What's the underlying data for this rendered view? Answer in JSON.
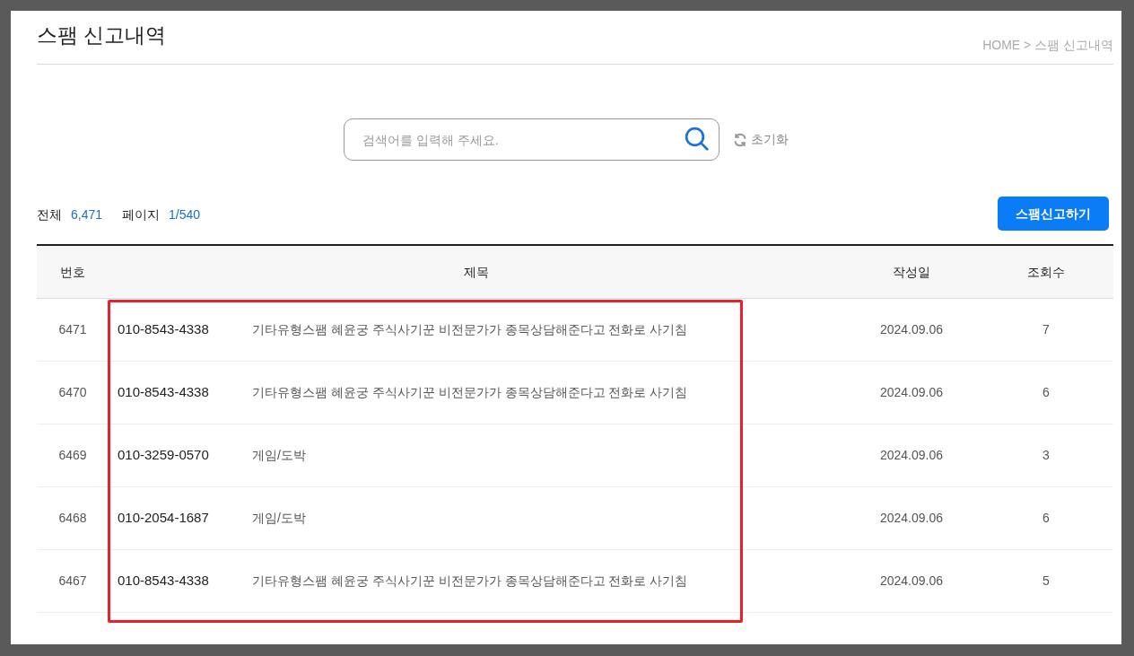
{
  "page_title": "스팸 신고내역",
  "breadcrumb": "HOME > 스팸 신고내역",
  "search": {
    "placeholder": "검색어를 입력해 주세요.",
    "reset_label": "초기화"
  },
  "summary": {
    "total_label": "전체",
    "total": "6,471",
    "page_label": "페이지",
    "page": "1/540"
  },
  "report_button": "스팸신고하기",
  "table": {
    "columns": [
      "번호",
      "제목",
      "작성일",
      "조회수"
    ],
    "rows": [
      {
        "number": "6471",
        "phone": "010-8543-4338",
        "title": "기타유형스팸 혜윤궁 주식사기꾼 비전문가가 종목상담해준다고 전화로 사기침",
        "date": "2024.09.06",
        "views": "7"
      },
      {
        "number": "6470",
        "phone": "010-8543-4338",
        "title": "기타유형스팸 혜윤궁 주식사기꾼 비전문가가 종목상담해준다고 전화로 사기침",
        "date": "2024.09.06",
        "views": "6"
      },
      {
        "number": "6469",
        "phone": "010-3259-0570",
        "title": "게임/도박",
        "date": "2024.09.06",
        "views": "3"
      },
      {
        "number": "6468",
        "phone": "010-2054-1687",
        "title": "게임/도박",
        "date": "2024.09.06",
        "views": "6"
      },
      {
        "number": "6467",
        "phone": "010-8543-4338",
        "title": "기타유형스팸 혜윤궁 주식사기꾼 비전문가가 종목상담해준다고 전화로 사기침",
        "date": "2024.09.06",
        "views": "5"
      }
    ]
  },
  "annotation": {
    "kind": "box"
  }
}
